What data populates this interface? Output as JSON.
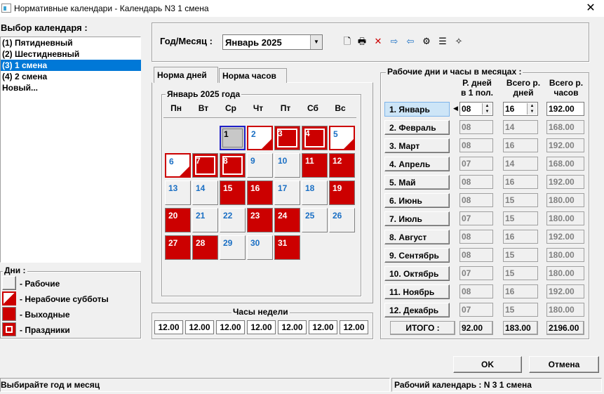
{
  "window": {
    "title": "Нормативные календари - Календарь N3 1 смена",
    "close": "✕"
  },
  "calendar_select": {
    "label": "Выбор календаря :",
    "items": [
      {
        "label": "(1) Пятидневный",
        "selected": false
      },
      {
        "label": "(2) Шестидневный",
        "selected": false
      },
      {
        "label": "(3) 1 смена",
        "selected": true
      },
      {
        "label": "(4) 2 смена",
        "selected": false
      },
      {
        "label": "Новый...",
        "selected": false
      }
    ]
  },
  "legend": {
    "label": "Дни :",
    "items": [
      "- Рабочие",
      "- Нерабочие субботы",
      "- Выходные",
      "- Праздники"
    ]
  },
  "year_month": {
    "label": "Год/Месяц :",
    "value": "Январь 2025"
  },
  "toolbar": [
    "new-icon",
    "print-icon",
    "delete-icon",
    "copy-icon",
    "paste-icon",
    "settings-icon",
    "list-icon",
    "wand-icon"
  ],
  "tabs": {
    "days": "Норма дней",
    "hours": "Норма часов"
  },
  "month": {
    "title": "Январь 2025 года",
    "weekdays": [
      "Пн",
      "Вт",
      "Ср",
      "Чт",
      "Пт",
      "Сб",
      "Вс"
    ],
    "days": [
      {
        "n": "1",
        "type": "selected"
      },
      {
        "n": "2",
        "type": "sat"
      },
      {
        "n": "3",
        "type": "hol"
      },
      {
        "n": "4",
        "type": "hol"
      },
      {
        "n": "5",
        "type": "sat"
      },
      {
        "n": "6",
        "type": "sat"
      },
      {
        "n": "7",
        "type": "hol"
      },
      {
        "n": "8",
        "type": "hol"
      },
      {
        "n": "9",
        "type": "work"
      },
      {
        "n": "10",
        "type": "work"
      },
      {
        "n": "11",
        "type": "off"
      },
      {
        "n": "12",
        "type": "off"
      },
      {
        "n": "13",
        "type": "work"
      },
      {
        "n": "14",
        "type": "work"
      },
      {
        "n": "15",
        "type": "off"
      },
      {
        "n": "16",
        "type": "off"
      },
      {
        "n": "17",
        "type": "work"
      },
      {
        "n": "18",
        "type": "work"
      },
      {
        "n": "19",
        "type": "off"
      },
      {
        "n": "20",
        "type": "off"
      },
      {
        "n": "21",
        "type": "work"
      },
      {
        "n": "22",
        "type": "work"
      },
      {
        "n": "23",
        "type": "off"
      },
      {
        "n": "24",
        "type": "off"
      },
      {
        "n": "25",
        "type": "work"
      },
      {
        "n": "26",
        "type": "work"
      },
      {
        "n": "27",
        "type": "off"
      },
      {
        "n": "28",
        "type": "off"
      },
      {
        "n": "29",
        "type": "work"
      },
      {
        "n": "30",
        "type": "work"
      },
      {
        "n": "31",
        "type": "off"
      }
    ]
  },
  "week_hours": {
    "label": "Часы недели",
    "values": [
      "12.00",
      "12.00",
      "12.00",
      "12.00",
      "12.00",
      "12.00",
      "12.00"
    ]
  },
  "monthly": {
    "label": "Рабочие дни и часы в месяцах :",
    "headers": [
      "Р. дней в 1 пол.",
      "Всего р. дней",
      "Всего р. часов"
    ],
    "header_lines": [
      [
        "Р. дней",
        "в 1 пол."
      ],
      [
        "Всего р.",
        "дней"
      ],
      [
        "Всего р.",
        "часов"
      ]
    ],
    "rows": [
      {
        "month": "1. Январь",
        "d1": "08",
        "days": "16",
        "hours": "192.00"
      },
      {
        "month": "2. Февраль",
        "d1": "08",
        "days": "14",
        "hours": "168.00"
      },
      {
        "month": "3. Март",
        "d1": "08",
        "days": "16",
        "hours": "192.00"
      },
      {
        "month": "4. Апрель",
        "d1": "07",
        "days": "14",
        "hours": "168.00"
      },
      {
        "month": "5. Май",
        "d1": "08",
        "days": "16",
        "hours": "192.00"
      },
      {
        "month": "6. Июнь",
        "d1": "08",
        "days": "15",
        "hours": "180.00"
      },
      {
        "month": "7. Июль",
        "d1": "07",
        "days": "15",
        "hours": "180.00"
      },
      {
        "month": "8. Август",
        "d1": "08",
        "days": "16",
        "hours": "192.00"
      },
      {
        "month": "9. Сентябрь",
        "d1": "08",
        "days": "15",
        "hours": "180.00"
      },
      {
        "month": "10. Октябрь",
        "d1": "07",
        "days": "15",
        "hours": "180.00"
      },
      {
        "month": "11. Ноябрь",
        "d1": "08",
        "days": "16",
        "hours": "192.00"
      },
      {
        "month": "12. Декабрь",
        "d1": "07",
        "days": "15",
        "hours": "180.00"
      }
    ],
    "total_label": "ИТОГО :",
    "totals": {
      "d1": "92.00",
      "days": "183.00",
      "hours": "2196.00"
    }
  },
  "buttons": {
    "ok": "OK",
    "cancel": "Отмена"
  },
  "status": {
    "left": "Выбирайте год и месяц",
    "right": "Рабочий календарь : N 3   1 смена"
  },
  "colors": {
    "red": "#cc0000",
    "blue_text": "#1a6fc4",
    "selection": "#0078d7"
  }
}
